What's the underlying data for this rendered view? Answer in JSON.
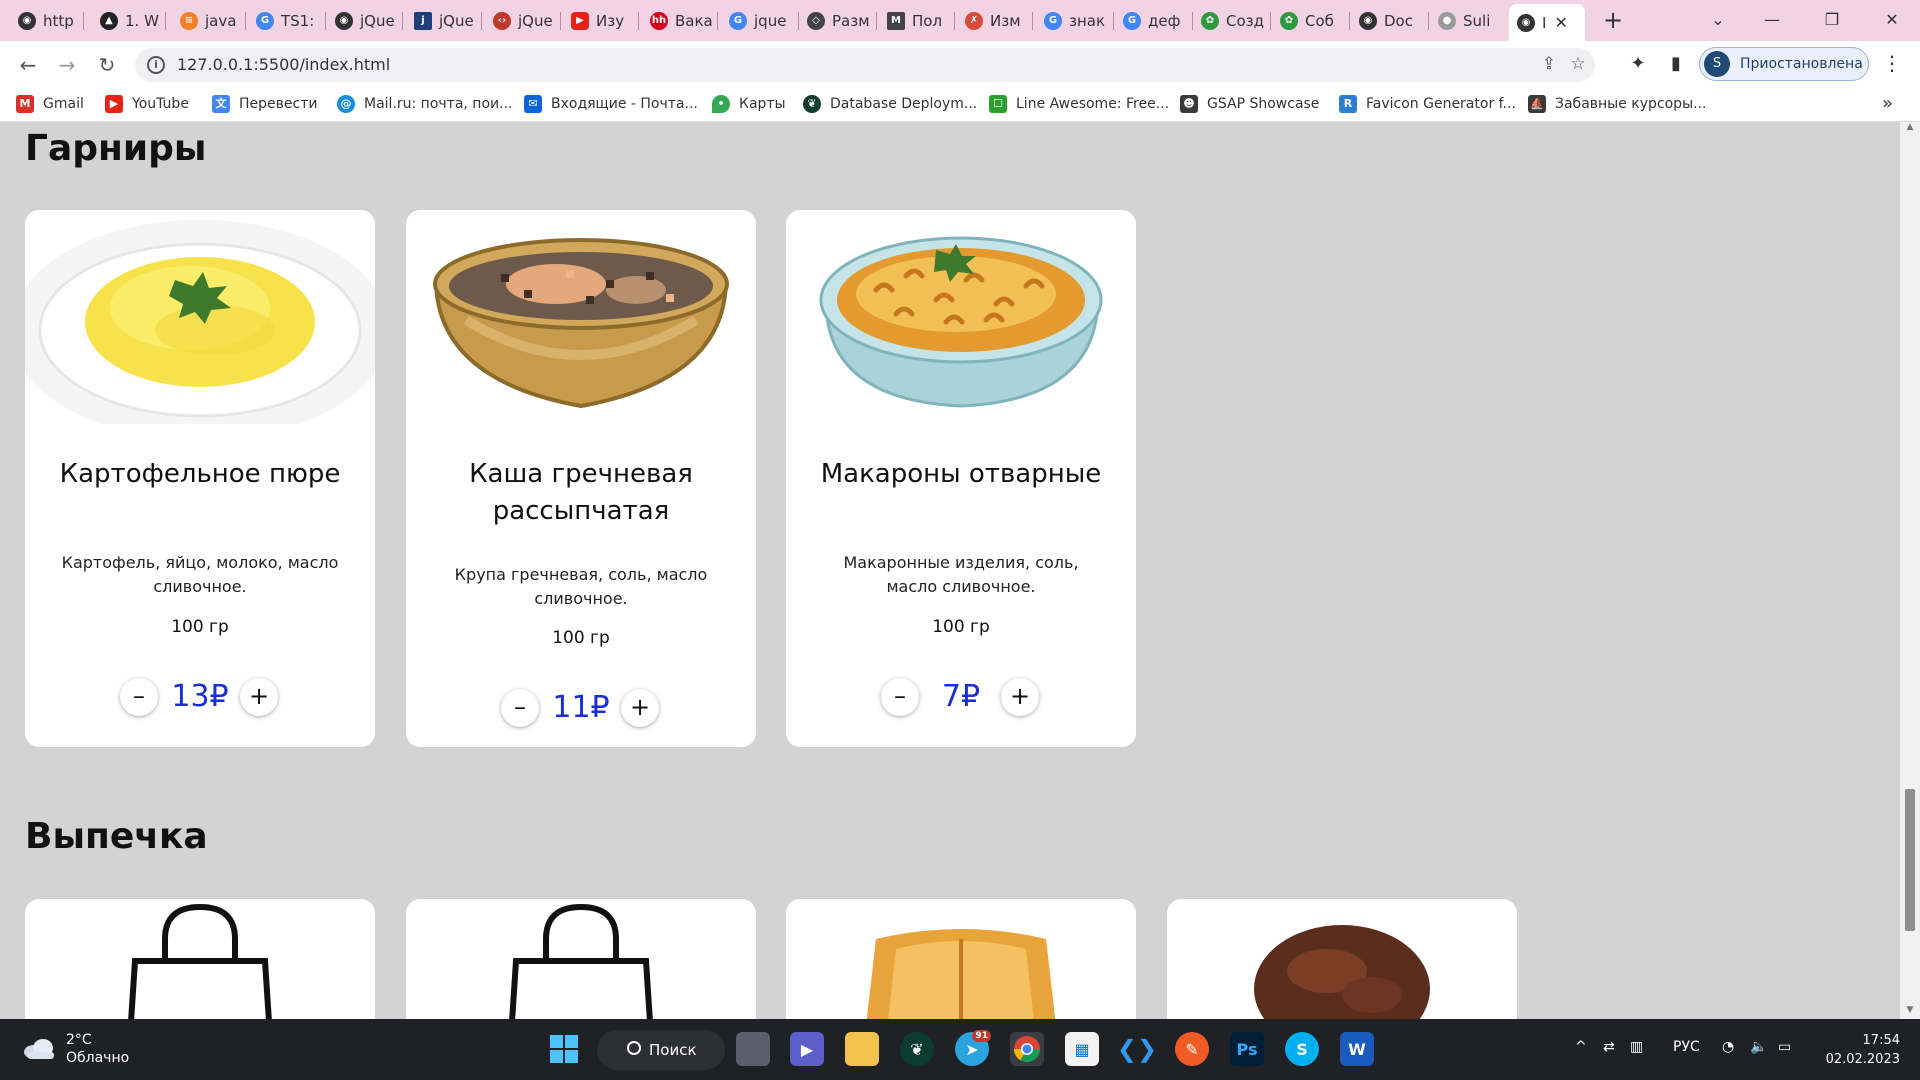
{
  "browser": {
    "tabs": [
      {
        "label": "http",
        "icon": "globe-icon",
        "color": "#333333"
      },
      {
        "label": "1. W",
        "icon": "hacker-icon",
        "color": "#222222"
      },
      {
        "label": "java",
        "icon": "stackoverflow-icon",
        "color": "#f48024"
      },
      {
        "label": "TS1:",
        "icon": "google-icon",
        "color": "#4285f4"
      },
      {
        "label": "jQue",
        "icon": "globe-icon",
        "color": "#333333"
      },
      {
        "label": "jQue",
        "icon": "jquery-icon",
        "color": "#1e3f7a"
      },
      {
        "label": "jQue",
        "icon": "code-icon",
        "color": "#c0392b"
      },
      {
        "label": "Изу",
        "icon": "youtube-icon",
        "color": "#e62117"
      },
      {
        "label": "Вака",
        "icon": "hh-icon",
        "color": "#d6001c"
      },
      {
        "label": "jque",
        "icon": "google-icon",
        "color": "#4285f4"
      },
      {
        "label": "Разм",
        "icon": "codepen-icon",
        "color": "#444444"
      },
      {
        "label": "Пол",
        "icon": "mail-icon",
        "color": "#444444"
      },
      {
        "label": "Изм",
        "icon": "figure-icon",
        "color": "#d94b3b"
      },
      {
        "label": "знак",
        "icon": "google-icon",
        "color": "#4285f4"
      },
      {
        "label": "деф",
        "icon": "google-icon",
        "color": "#4285f4"
      },
      {
        "label": "Созд",
        "icon": "leaf-icon",
        "color": "#2e9a3e"
      },
      {
        "label": "Соб",
        "icon": "leaf-icon",
        "color": "#2e9a3e"
      },
      {
        "label": "Doc",
        "icon": "globe-icon",
        "color": "#333333"
      },
      {
        "label": "Suli",
        "icon": "github-icon",
        "color": "#999999"
      },
      {
        "label": "I",
        "icon": "globe-icon",
        "color": "#333333",
        "active": true
      }
    ],
    "url": "127.0.0.1:5500/index.html",
    "profile_initial": "S",
    "profile_label": "Приостановлена",
    "bookmarks": [
      {
        "label": "Gmail",
        "icon": "gmail-icon",
        "color": "#d93025"
      },
      {
        "label": "YouTube",
        "icon": "youtube-icon",
        "color": "#e62117"
      },
      {
        "label": "Перевести",
        "icon": "translate-icon",
        "color": "#4285f4"
      },
      {
        "label": "Mail.ru: почта, пои...",
        "icon": "mailru-icon",
        "color": "#168de2"
      },
      {
        "label": "Входящие - Почта...",
        "icon": "outlook-icon",
        "color": "#0a64d6"
      },
      {
        "label": "Карты",
        "icon": "maps-icon",
        "color": "#34a853"
      },
      {
        "label": "Database Deploym...",
        "icon": "mongodb-icon",
        "color": "#0b3d2e"
      },
      {
        "label": "Line Awesome: Free...",
        "icon": "lineawesome-icon",
        "color": "#2ca02c"
      },
      {
        "label": "GSAP Showcase",
        "icon": "gsap-icon",
        "color": "#3a3a3a"
      },
      {
        "label": "Favicon Generator f...",
        "icon": "realfavicon-icon",
        "color": "#2d7dd2"
      },
      {
        "label": "Забавные курсоры...",
        "icon": "cursor-icon",
        "color": "#3a3a3a"
      }
    ]
  },
  "page": {
    "sections": [
      {
        "title": "Гарниры",
        "products": [
          {
            "name": "Картофельное пюре",
            "ingredients": "Картофель, яйцо, молоко, масло сливочное.",
            "weight": "100 гр",
            "price": "13₽",
            "minus": "–",
            "plus": "+",
            "image": "mashed-potatoes-image"
          },
          {
            "name": "Каша гречневая рассыпчатая",
            "ingredients": "Крупа гречневая, соль, масло сливочное.",
            "weight": "100 гр",
            "price": "11₽",
            "minus": "–",
            "plus": "+",
            "image": "buckwheat-image"
          },
          {
            "name": "Макароны отварные",
            "ingredients": "Макаронные изделия, соль, масло сливочное.",
            "weight": "100 гр",
            "price": "7₽",
            "minus": "–",
            "plus": "+",
            "image": "pasta-image"
          }
        ]
      },
      {
        "title": "Выпечка",
        "products": [
          {
            "image": "shopping-bag-icon"
          },
          {
            "image": "shopping-bag-icon"
          },
          {
            "image": "puff-pastry-image"
          },
          {
            "image": "chocolate-muffin-image"
          }
        ]
      }
    ]
  },
  "taskbar": {
    "weather_temp": "2°C",
    "weather_text": "Облачно",
    "search_label": "Поиск",
    "telegram_badge": "91",
    "language": "РУС",
    "time": "17:54",
    "date": "02.02.2023"
  }
}
